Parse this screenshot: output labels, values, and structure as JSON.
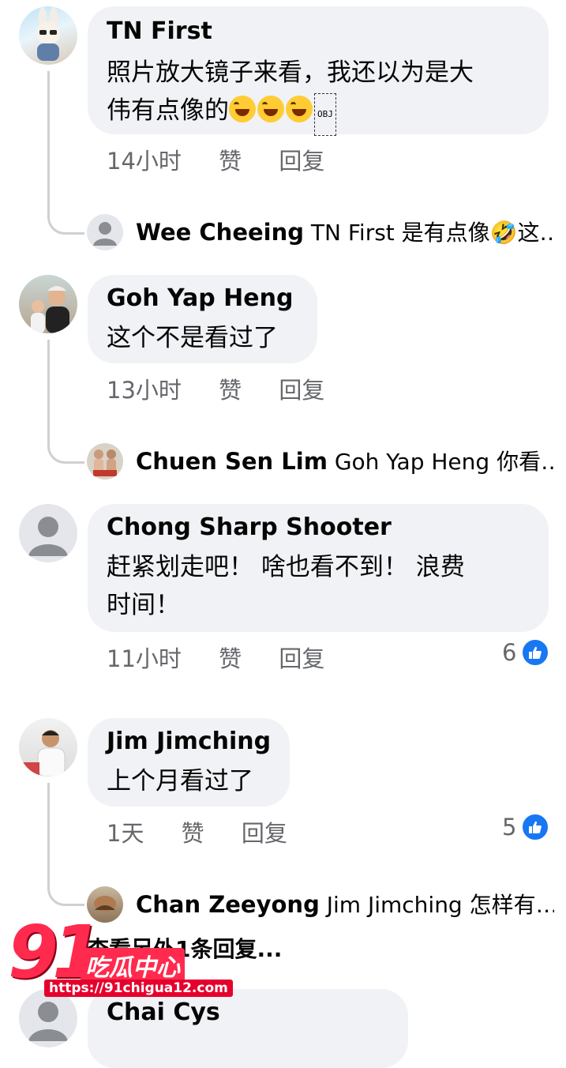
{
  "comments": [
    {
      "name": "TN First",
      "text_lines": [
        "照片放大镜子来看，我还以为是大",
        "伟有点像的"
      ],
      "emoji_count": 3,
      "obj_label": "OBJ",
      "time": "14小时",
      "like_label": "赞",
      "reply_label": "回复",
      "reply": {
        "name": "Wee Cheeing",
        "preview": " TN First 是有点像🤣这…"
      }
    },
    {
      "name": "Goh Yap Heng",
      "text_lines": [
        "这个不是看过了"
      ],
      "time": "13小时",
      "like_label": "赞",
      "reply_label": "回复",
      "reply": {
        "name": "Chuen Sen Lim",
        "preview": " Goh Yap Heng 你看…"
      }
    },
    {
      "name": "Chong Sharp Shooter",
      "text_lines": [
        "赶紧划走吧！ 啥也看不到！ 浪费",
        "时间！"
      ],
      "time": "11小时",
      "like_label": "赞",
      "reply_label": "回复",
      "likes": "6"
    },
    {
      "name": "Jim Jimching",
      "text_lines": [
        "上个月看过了"
      ],
      "time": "1天",
      "like_label": "赞",
      "reply_label": "回复",
      "likes": "5",
      "reply": {
        "name": "Chan Zeeyong",
        "preview": " Jim Jimching 怎样有…"
      },
      "more_replies": "查看另外1条回复..."
    },
    {
      "name": "Chai Cys"
    }
  ],
  "watermark": {
    "number": "91",
    "brand": "吃瓜中心",
    "url": "https://91chigua12.com"
  },
  "colors": {
    "bubble": "#f0f2f5",
    "meta": "#65676b",
    "like_blue": "#1877f2",
    "watermark": "#ff2a4d"
  },
  "icons": [
    "default-avatar-icon",
    "like-thumb-icon",
    "laughing-emoji-icon"
  ]
}
